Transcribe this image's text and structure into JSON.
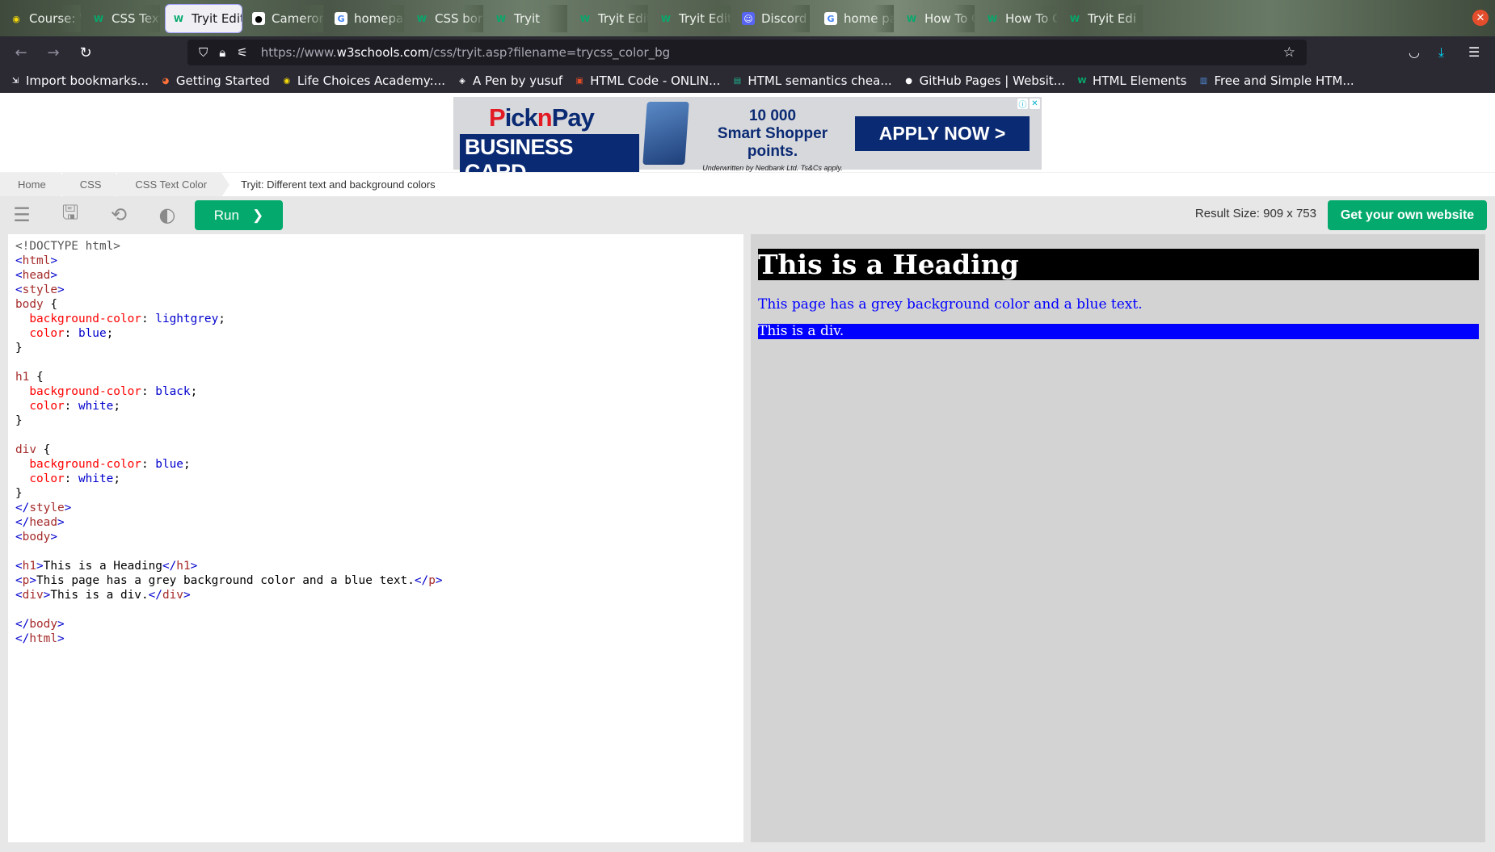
{
  "tabs": [
    {
      "label": "Course: We",
      "icon": "lifechoices-icon",
      "active": false
    },
    {
      "label": "CSS Text",
      "icon": "w3schools-icon",
      "active": false
    },
    {
      "label": "Tryit Edit",
      "icon": "w3schools-icon",
      "active": true
    },
    {
      "label": "Cameron",
      "icon": "github-icon",
      "active": false
    },
    {
      "label": "homepage",
      "icon": "google-icon",
      "active": false
    },
    {
      "label": "CSS bor",
      "icon": "w3schools-icon",
      "active": false
    },
    {
      "label": "Tryit",
      "icon": "w3schools-icon",
      "active": false
    },
    {
      "label": "Tryit Editor",
      "icon": "w3schools-icon",
      "active": false
    },
    {
      "label": "Tryit Editor",
      "icon": "w3schools-icon",
      "active": false
    },
    {
      "label": "Discord",
      "icon": "discord-icon",
      "active": false
    },
    {
      "label": "home page",
      "icon": "google-icon",
      "active": false
    },
    {
      "label": "How To Cre",
      "icon": "w3schools-icon",
      "active": false
    },
    {
      "label": "How To Cr",
      "icon": "w3schools-icon",
      "active": false
    },
    {
      "label": "Tryit Edi",
      "icon": "w3schools-icon",
      "active": false
    }
  ],
  "url": {
    "prefix": "https://www.",
    "domain": "w3schools.com",
    "path": "/css/tryit.asp?filename=trycss_color_bg"
  },
  "bookmarks": [
    {
      "label": "Import bookmarks...",
      "icon": "import-icon"
    },
    {
      "label": "Getting Started",
      "icon": "firefox-icon"
    },
    {
      "label": "Life Choices Academy:...",
      "icon": "lifechoices-icon"
    },
    {
      "label": "A Pen by yusuf",
      "icon": "codepen-icon"
    },
    {
      "label": "HTML Code - ONLIN...",
      "icon": "html-icon"
    },
    {
      "label": "HTML semantics chea...",
      "icon": "semantics-icon"
    },
    {
      "label": "GitHub Pages | Websit...",
      "icon": "github-icon"
    },
    {
      "label": "HTML Elements",
      "icon": "w3schools-icon"
    },
    {
      "label": "Free and Simple HTM...",
      "icon": "page-icon"
    }
  ],
  "ad": {
    "logo_brand": "Pick n Pay",
    "logo_line": "BUSINESS CARD",
    "points": "10 000",
    "points_label": "Smart Shopper points.",
    "underwritten": "Underwritten by Nedbank Ltd. Ts&Cs apply.",
    "cta": "APPLY NOW >"
  },
  "breadcrumb": {
    "items": [
      "Home",
      "CSS",
      "CSS Text Color"
    ],
    "current": "Tryit: Different text and background colors"
  },
  "toolbar": {
    "run_label": "Run",
    "run_arrow": "❯",
    "result_size": "Result Size: 909 x 753",
    "own_site": "Get your own website"
  },
  "code_lines": [
    "<!DOCTYPE html>",
    "<html>",
    "<head>",
    "<style>",
    "body {",
    "  background-color: lightgrey;",
    "  color: blue;",
    "}",
    "",
    "h1 {",
    "  background-color: black;",
    "  color: white;",
    "}",
    "",
    "div {",
    "  background-color: blue;",
    "  color: white;",
    "}",
    "</style>",
    "</head>",
    "<body>",
    "",
    "<h1>This is a Heading</h1>",
    "<p>This page has a grey background color and a blue text.</p>",
    "<div>This is a div.</div>",
    "",
    "</body>",
    "</html>"
  ],
  "result": {
    "heading": "This is a Heading",
    "paragraph": "This page has a grey background color and a blue text.",
    "div": "This is a div."
  },
  "colors": {
    "accent": "#04aa6d",
    "result_bg": "#d3d3d3",
    "h1_bg": "#000000",
    "div_bg": "#0000ff"
  }
}
